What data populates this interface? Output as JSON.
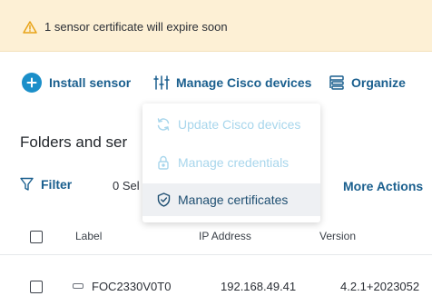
{
  "alert": {
    "text": "1 sensor certificate will expire soon",
    "icon": "warning-triangle-icon",
    "icon_color": "#e8a317"
  },
  "toolbar": {
    "install_label": "Install sensor",
    "manage_label": "Manage Cisco devices",
    "organize_label": "Organize",
    "accent": "#1a5f8e",
    "install_circle_color": "#1b8fc9"
  },
  "section": {
    "title": "Folders and ser"
  },
  "filter_bar": {
    "filter_label": "Filter",
    "selected_label": "0 Sel",
    "more_actions_label": "More Actions"
  },
  "table": {
    "columns": [
      "Label",
      "IP Address",
      "Version"
    ],
    "rows": [
      {
        "label": "FOC2330V0T0",
        "ip": "192.168.49.41",
        "version": "4.2.1+2023052"
      }
    ]
  },
  "dropdown": {
    "items": [
      {
        "label": "Update Cisco devices",
        "icon": "refresh-icon",
        "state": "disabled"
      },
      {
        "label": "Manage credentials",
        "icon": "lock-icon",
        "state": "disabled"
      },
      {
        "label": "Manage certificates",
        "icon": "shield-check-icon",
        "state": "hover"
      }
    ],
    "disabled_color": "#a8d6ec"
  }
}
